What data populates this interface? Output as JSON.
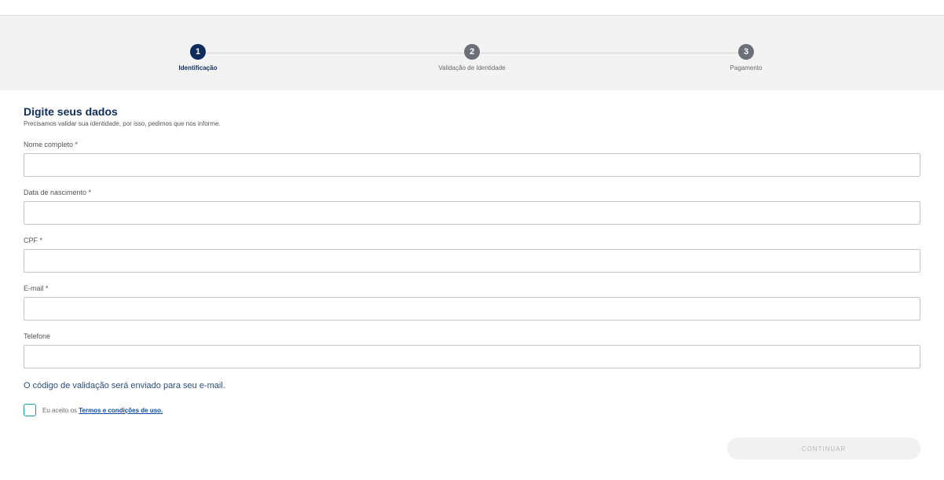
{
  "stepper": {
    "steps": [
      {
        "number": "1",
        "label": "Identificação",
        "active": true
      },
      {
        "number": "2",
        "label": "Validação de Identidade",
        "active": false
      },
      {
        "number": "3",
        "label": "Pagamento",
        "active": false
      }
    ]
  },
  "form": {
    "title": "Digite seus dados",
    "subtitle": "Precisamos validar sua identidade, por isso, pedimos que nos informe.",
    "fields": [
      {
        "label": "Nome completo *",
        "value": "",
        "placeholder": ""
      },
      {
        "label": "Data de nascimento *",
        "value": "",
        "placeholder": ""
      },
      {
        "label": "CPF *",
        "value": "",
        "placeholder": ""
      },
      {
        "label": "E-mail *",
        "value": "",
        "placeholder": ""
      },
      {
        "label": "Telefone",
        "value": "",
        "placeholder": ""
      }
    ],
    "validation_note": "O código de validação será enviado para seu e-mail.",
    "terms_prefix": "Eu aceito os",
    "terms_link": "Termos e condições de uso.",
    "terms_checked": false,
    "continue_label": "CONTINUAR"
  },
  "colors": {
    "primary": "#0d2c5c",
    "step_inactive": "#6b6f77",
    "checkbox_border": "#1c9bb3",
    "link": "#0d4fa6",
    "band": "#f3f3f3"
  }
}
